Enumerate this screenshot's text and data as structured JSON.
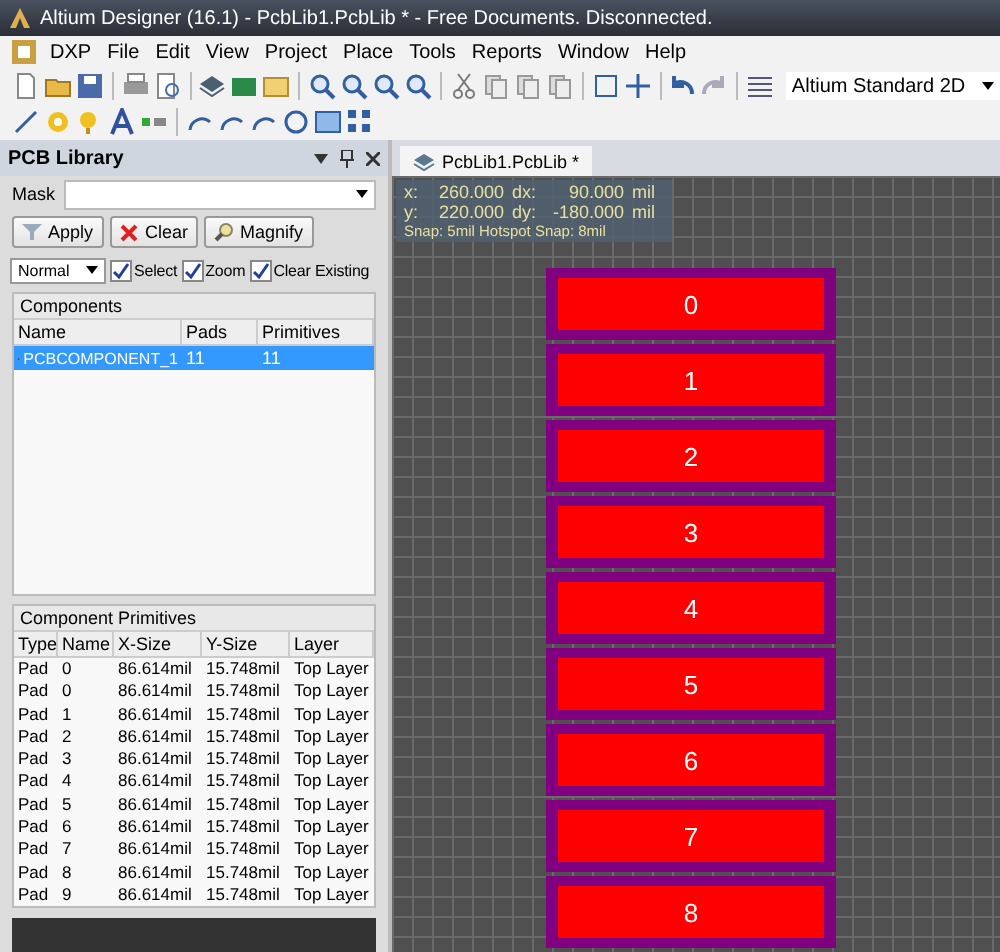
{
  "window": {
    "title": "Altium Designer (16.1) - PcbLib1.PcbLib * - Free Documents. Disconnected."
  },
  "menu": [
    {
      "label": "DXP"
    },
    {
      "label": "File"
    },
    {
      "label": "Edit"
    },
    {
      "label": "View"
    },
    {
      "label": "Project"
    },
    {
      "label": "Place"
    },
    {
      "label": "Tools"
    },
    {
      "label": "Reports"
    },
    {
      "label": "Window"
    },
    {
      "label": "Help"
    }
  ],
  "view_dropdown": {
    "value": "Altium Standard 2D"
  },
  "panel": {
    "title": "PCB Library",
    "mask_label": "Mask",
    "buttons": [
      {
        "label": "Apply"
      },
      {
        "label": "Clear"
      },
      {
        "label": "Magnify"
      }
    ],
    "mode": {
      "value": "Normal"
    },
    "checkboxes": [
      {
        "label": "Select",
        "checked": true
      },
      {
        "label": "Zoom",
        "checked": true
      },
      {
        "label": "Clear Existing",
        "checked": true
      }
    ],
    "components": {
      "title": "Components",
      "columns": [
        "Name",
        "Pads",
        "Primitives"
      ],
      "rows": [
        {
          "cells": [
            "PCBCOMPONENT_1",
            "11",
            "11"
          ],
          "selected": true
        }
      ]
    },
    "primitives": {
      "title": "Component Primitives",
      "columns": [
        "Type",
        "Name",
        "X-Size",
        "Y-Size",
        "Layer"
      ],
      "rows": [
        [
          "Pad",
          "0",
          "86.614mil",
          "15.748mil",
          "Top Layer"
        ],
        [
          "Pad",
          "0",
          "86.614mil",
          "15.748mil",
          "Top Layer"
        ],
        [
          "Pad",
          "1",
          "86.614mil",
          "15.748mil",
          "Top Layer"
        ],
        [
          "Pad",
          "2",
          "86.614mil",
          "15.748mil",
          "Top Layer"
        ],
        [
          "Pad",
          "3",
          "86.614mil",
          "15.748mil",
          "Top Layer"
        ],
        [
          "Pad",
          "4",
          "86.614mil",
          "15.748mil",
          "Top Layer"
        ],
        [
          "Pad",
          "5",
          "86.614mil",
          "15.748mil",
          "Top Layer"
        ],
        [
          "Pad",
          "6",
          "86.614mil",
          "15.748mil",
          "Top Layer"
        ],
        [
          "Pad",
          "7",
          "86.614mil",
          "15.748mil",
          "Top Layer"
        ],
        [
          "Pad",
          "8",
          "86.614mil",
          "15.748mil",
          "Top Layer"
        ],
        [
          "Pad",
          "9",
          "86.614mil",
          "15.748mil",
          "Top Layer"
        ]
      ]
    }
  },
  "document_tab": {
    "label": "PcbLib1.PcbLib *",
    "selected": true
  },
  "coordinates": {
    "rows": [
      [
        "x:",
        "260.000",
        "dx:",
        "90.000",
        "mil"
      ],
      [
        "y:",
        "220.000",
        "dy:",
        "-180.000",
        "mil"
      ]
    ],
    "snap": "Snap: 5mil Hotspot Snap: 8mil"
  },
  "pads": [
    {
      "label": "0"
    },
    {
      "label": "1"
    },
    {
      "label": "2"
    },
    {
      "label": "3"
    },
    {
      "label": "4"
    },
    {
      "label": "5"
    },
    {
      "label": "6"
    },
    {
      "label": "7"
    },
    {
      "label": "8"
    }
  ]
}
